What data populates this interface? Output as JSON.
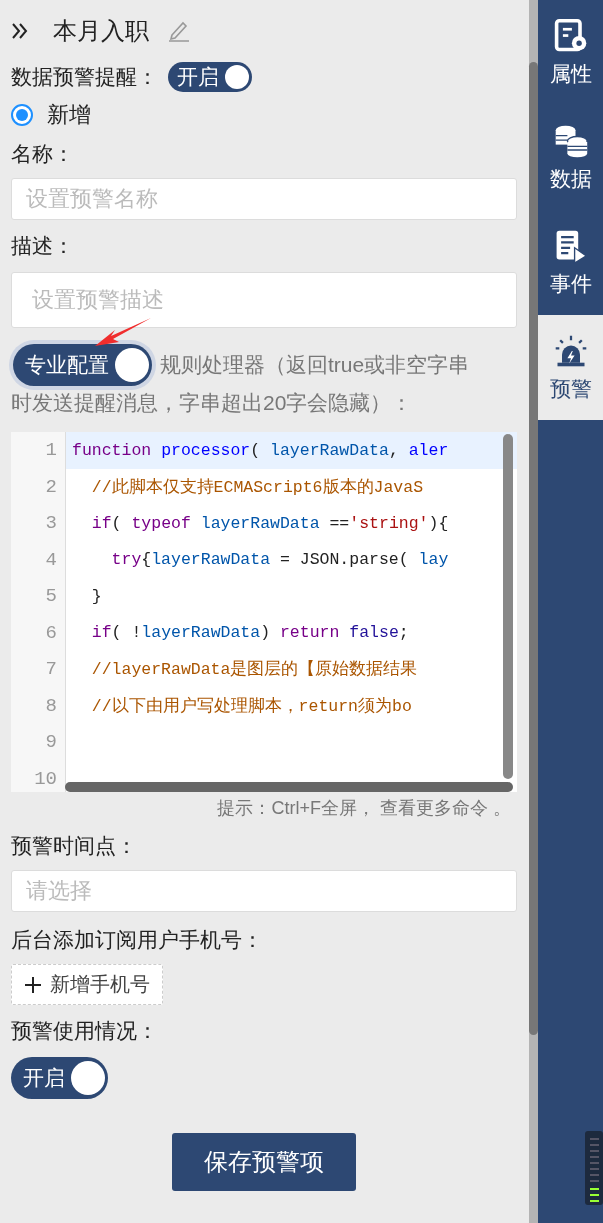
{
  "header": {
    "title": "本月入职"
  },
  "alert_toggle": {
    "label": "数据预警提醒：",
    "text": "开启",
    "on": true
  },
  "mode_options": [
    {
      "label": "新增",
      "selected": true
    }
  ],
  "name_field": {
    "label": "名称：",
    "placeholder": "设置预警名称"
  },
  "description_field": {
    "label": "描述：",
    "placeholder": "设置预警描述"
  },
  "pro_config": {
    "text": "专业配置",
    "on": true,
    "description_lines": [
      "规则处理器（返回true或非空字串",
      "时发送提醒消息，字串超出20字会隐藏）："
    ]
  },
  "code_editor": {
    "lines": [
      {
        "number": "1",
        "highlighted": true,
        "tokens": [
          {
            "kind": "keyword",
            "text": "function "
          },
          {
            "kind": "def",
            "text": "processor"
          },
          {
            "kind": "plain",
            "text": "( "
          },
          {
            "kind": "variable",
            "text": "layerRawData"
          },
          {
            "kind": "plain",
            "text": ", "
          },
          {
            "kind": "def",
            "text": "aler"
          }
        ]
      },
      {
        "number": "2",
        "highlighted": false,
        "tokens": [
          {
            "kind": "comment",
            "text": "  //此脚本仅支持ECMAScript6版本的JavaS"
          }
        ]
      },
      {
        "number": "3",
        "highlighted": false,
        "tokens": [
          {
            "kind": "keyword",
            "text": "  if"
          },
          {
            "kind": "plain",
            "text": "( "
          },
          {
            "kind": "keyword",
            "text": "typeof "
          },
          {
            "kind": "variable",
            "text": "layerRawData"
          },
          {
            "kind": "plain",
            "text": " =="
          },
          {
            "kind": "string",
            "text": "'string'"
          },
          {
            "kind": "plain",
            "text": "){"
          }
        ]
      },
      {
        "number": "4",
        "highlighted": false,
        "tokens": [
          {
            "kind": "keyword",
            "text": "    try"
          },
          {
            "kind": "plain",
            "text": "{"
          },
          {
            "kind": "variable",
            "text": "layerRawData"
          },
          {
            "kind": "plain",
            "text": " = JSON.parse( "
          },
          {
            "kind": "variable",
            "text": "lay"
          }
        ]
      },
      {
        "number": "5",
        "highlighted": false,
        "tokens": [
          {
            "kind": "plain",
            "text": "  }"
          }
        ]
      },
      {
        "number": "6",
        "highlighted": false,
        "tokens": [
          {
            "kind": "keyword",
            "text": "  if"
          },
          {
            "kind": "plain",
            "text": "( !"
          },
          {
            "kind": "variable",
            "text": "layerRawData"
          },
          {
            "kind": "plain",
            "text": ") "
          },
          {
            "kind": "keyword",
            "text": "return "
          },
          {
            "kind": "atom",
            "text": "false"
          },
          {
            "kind": "plain",
            "text": ";"
          }
        ]
      },
      {
        "number": "7",
        "highlighted": false,
        "tokens": [
          {
            "kind": "comment",
            "text": "  //layerRawData是图层的【原始数据结果"
          }
        ]
      },
      {
        "number": "8",
        "highlighted": false,
        "tokens": [
          {
            "kind": "comment",
            "text": "  //以下由用户写处理脚本，return须为bo"
          }
        ]
      },
      {
        "number": "9",
        "highlighted": false
      },
      {
        "number": "10",
        "highlighted": false
      }
    ],
    "hint": "提示：Ctrl+F全屏， 查看更多命令 。"
  },
  "time_field": {
    "label": "预警时间点：",
    "placeholder": "请选择"
  },
  "subscribers": {
    "label": "后台添加订阅用户手机号：",
    "add_button": "新增手机号"
  },
  "usage": {
    "label": "预警使用情况：",
    "text": "开启",
    "on": true
  },
  "save_button": "保存预警项",
  "sidebar": {
    "items": [
      {
        "label": "属性",
        "selected": false
      },
      {
        "label": "数据",
        "selected": false
      },
      {
        "label": "事件",
        "selected": false
      },
      {
        "label": "预警",
        "selected": true
      }
    ]
  }
}
